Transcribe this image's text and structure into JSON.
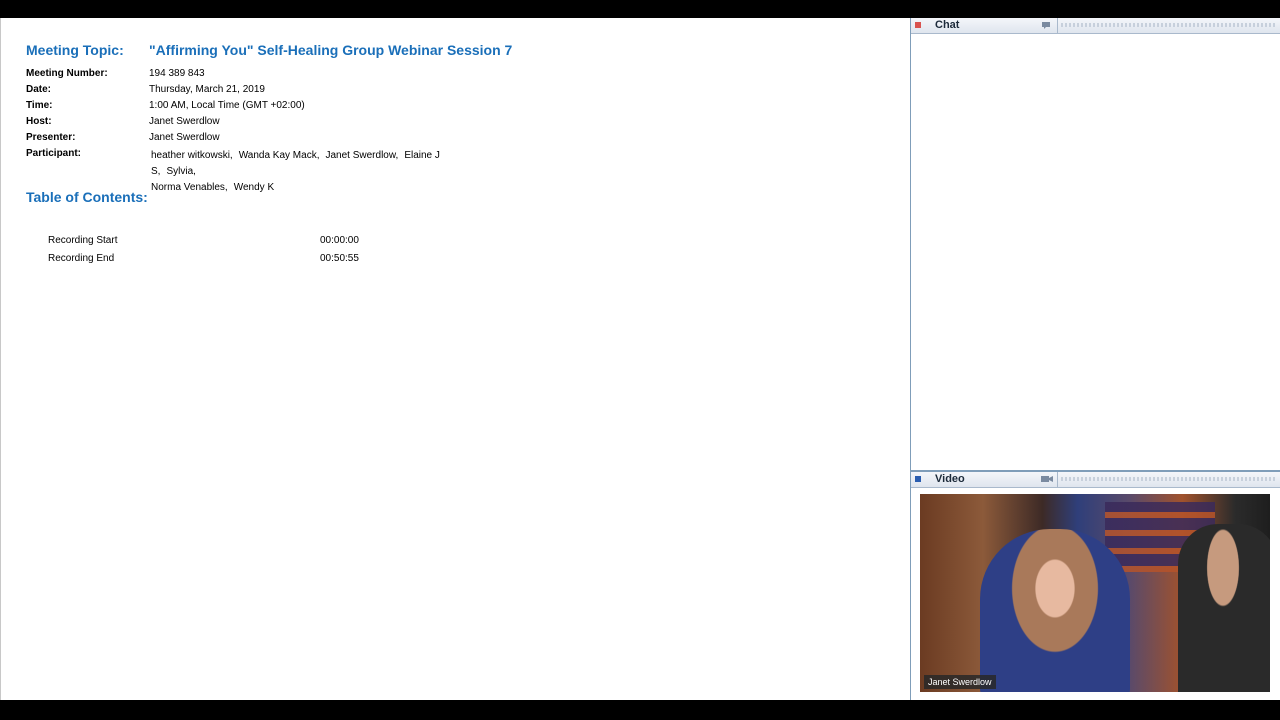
{
  "meeting": {
    "topic_label": "Meeting Topic:",
    "topic": "\"Affirming You\" Self-Healing Group Webinar Session 7",
    "number_label": "Meeting Number:",
    "number": "194 389 843",
    "date_label": "Date:",
    "date": "Thursday, March 21, 2019",
    "time_label": "Time:",
    "time": "1:00 AM, Local Time (GMT +02:00)",
    "host_label": "Host:",
    "host": "Janet Swerdlow",
    "presenter_label": "Presenter:",
    "presenter": "Janet Swerdlow",
    "participant_label": "Participant:",
    "participants": [
      "heather witkowski,",
      "Wanda Kay Mack,",
      "Janet Swerdlow,",
      "Elaine J S,",
      "Sylvia,",
      "Norma Venables,",
      "Wendy K"
    ]
  },
  "toc": {
    "title": "Table of Contents:",
    "rows": [
      {
        "label": "Recording Start",
        "time": "00:00:00"
      },
      {
        "label": "Recording End",
        "time": "00:50:55"
      }
    ]
  },
  "chat_panel": {
    "title": "Chat",
    "icon": "speech-bubble-icon",
    "dot_color": "#d9534f"
  },
  "video_panel": {
    "title": "Video",
    "icon": "video-camera-icon",
    "dot_color": "#2a5db0",
    "speaker_name": "Janet Swerdlow"
  },
  "colors": {
    "accent": "#1a6fb9",
    "background": "#000000"
  }
}
